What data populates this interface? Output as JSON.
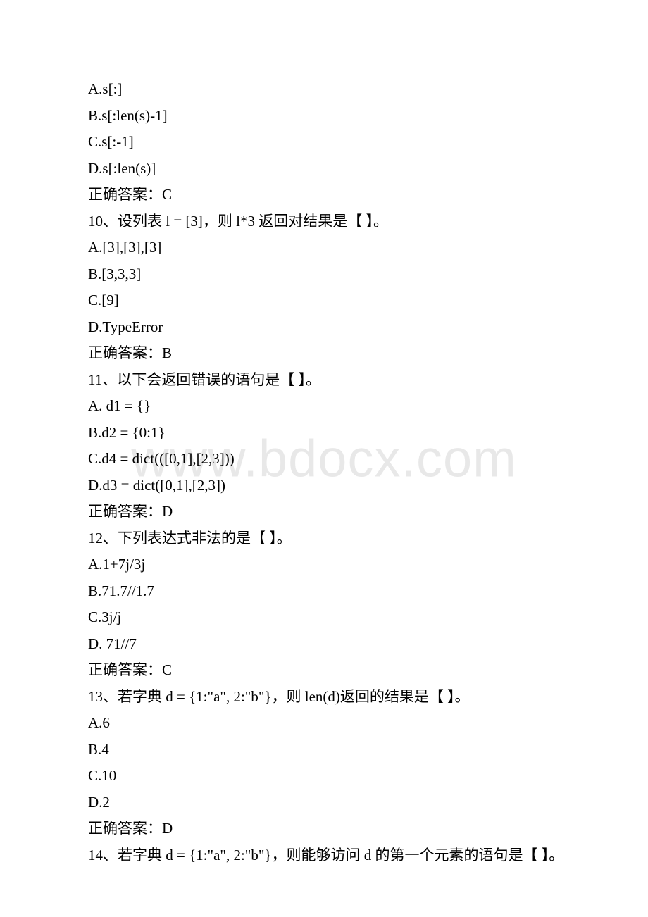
{
  "watermark": "www.bdocx.com",
  "lines": [
    "A.s[:]",
    "B.s[:len(s)-1]",
    "C.s[:-1]",
    "D.s[:len(s)]",
    "正确答案：C",
    "10、设列表 l = [3]，则 l*3 返回对结果是【 】。",
    "A.[3],[3],[3]",
    "B.[3,3,3]",
    "C.[9]",
    "D.TypeError",
    "正确答案：B",
    "11、以下会返回错误的语句是【 】。",
    "A. d1 = {}",
    "B.d2 = {0:1}",
    "C.d4 = dict(([0,1],[2,3]))",
    "D.d3 = dict([0,1],[2,3])",
    "正确答案：D",
    "12、下列表达式非法的是【 】。",
    "A.1+7j/3j",
    "B.71.7//1.7",
    "C.3j/j",
    "D. 71//7",
    "正确答案：C",
    "13、若字典 d = {1:\"a\", 2:\"b\"}，则 len(d)返回的结果是【 】。",
    "A.6",
    "B.4",
    "C.10",
    "D.2",
    "正确答案：D",
    "14、若字典 d = {1:\"a\", 2:\"b\"}，则能够访问 d 的第一个元素的语句是【 】。"
  ]
}
